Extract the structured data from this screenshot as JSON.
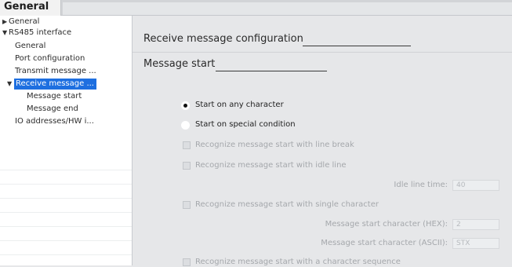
{
  "tab": {
    "label": "General"
  },
  "nav": {
    "items": [
      {
        "label": "General",
        "level": 0,
        "arrow": "right"
      },
      {
        "label": "RS485 interface",
        "level": 0,
        "arrow": "down"
      },
      {
        "label": "General",
        "level": 1
      },
      {
        "label": "Port configuration",
        "level": 1
      },
      {
        "label": "Transmit message ...",
        "level": 1
      },
      {
        "label": "Receive message ...",
        "level": 1,
        "arrow": "down",
        "selected": true
      },
      {
        "label": "Message start",
        "level": 2
      },
      {
        "label": "Message end",
        "level": 2
      },
      {
        "label": "IO addresses/HW i...",
        "level": 1
      }
    ]
  },
  "panel": {
    "section_title": "Receive message configuration",
    "subsection_title": "Message start",
    "options": {
      "start_any": "Start on any character",
      "start_special": "Start on special condition",
      "line_break": "Recognize message start with line break",
      "idle_line": "Recognize message start with idle line",
      "single_char": "Recognize message start with single character",
      "char_sequence": "Recognize message start with a character sequence"
    },
    "fields": {
      "idle_line_time": {
        "label": "Idle line time:",
        "value": "40"
      },
      "start_char_hex": {
        "label": "Message start character (HEX):",
        "value": "2"
      },
      "start_char_ascii": {
        "label": "Message start character (ASCII):",
        "value": "STX"
      }
    }
  },
  "colors": {
    "selection": "#1e6fe0",
    "panel_bg": "#e6e7e9",
    "disabled_text": "#a5a8ac"
  }
}
